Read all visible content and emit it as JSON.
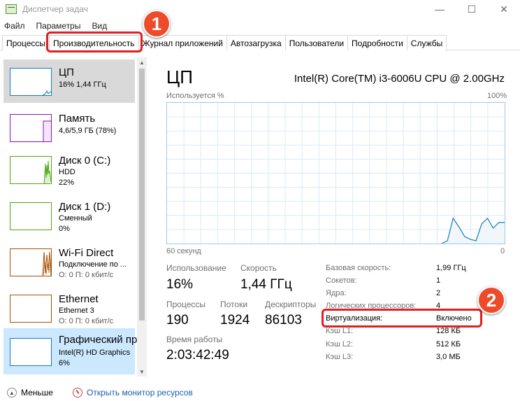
{
  "window": {
    "title": "Диспетчер задач",
    "controls": {
      "minimize": "—",
      "maximize": "☐",
      "close": "✕"
    }
  },
  "menu": [
    "Файл",
    "Параметры",
    "Вид"
  ],
  "tabs": [
    {
      "label": "Процессы"
    },
    {
      "label": "Производительность"
    },
    {
      "label": "Журнал приложений"
    },
    {
      "label": "Автозагрузка"
    },
    {
      "label": "Пользователи"
    },
    {
      "label": "Подробности"
    },
    {
      "label": "Службы"
    }
  ],
  "sidebar": {
    "items": [
      {
        "title": "ЦП",
        "sub1": "16% 1,44 ГГц",
        "color": "#117dbb"
      },
      {
        "title": "Память",
        "sub1": "4,6/5,9 ГБ (78%)",
        "color": "#8b12ae"
      },
      {
        "title": "Диск 0 (C:)",
        "sub1": "HDD",
        "sub2": "22%",
        "color": "#4da60c"
      },
      {
        "title": "Диск 1 (D:)",
        "sub1": "Сменный",
        "sub2": "0%",
        "color": "#4da60c"
      },
      {
        "title": "Wi-Fi Direct",
        "sub1": "Подключение по ...",
        "sub2": "О: 0 П: 0 кбит/с",
        "color": "#a74f01"
      },
      {
        "title": "Ethernet",
        "sub1": "Ethernet 3",
        "sub2": "О: 0 П: 0 кбит/с",
        "color": "#a74f01"
      },
      {
        "title": "Графический пр",
        "sub1": "Intel(R) HD Graphics",
        "sub2": "6%",
        "color": "#117dbb"
      }
    ]
  },
  "main": {
    "title": "ЦП",
    "cpu_name": "Intel(R) Core(TM) i3-6006U CPU @ 2.00GHz",
    "graph": {
      "top_left": "Используется %",
      "top_right": "100%",
      "bottom_left": "60 секунд",
      "bottom_right": "0",
      "line_color": "#117dbb",
      "usage_values": [
        0,
        0,
        0,
        0,
        0,
        0,
        0,
        0,
        0,
        0,
        0,
        0,
        0,
        0,
        0,
        0,
        0,
        0,
        0,
        0,
        0,
        0,
        0,
        0,
        0,
        0,
        0,
        0,
        0,
        0,
        0,
        0,
        0,
        0,
        0,
        0,
        0,
        0,
        0,
        0,
        0,
        0,
        0,
        0,
        0,
        0,
        0,
        0,
        0,
        2,
        18,
        12,
        5,
        3,
        2,
        14,
        18,
        11,
        15,
        15
      ]
    },
    "stats": {
      "utilization": {
        "label": "Использование",
        "value": "16%"
      },
      "speed": {
        "label": "Скорость",
        "value": "1,44 ГГц"
      },
      "processes": {
        "label": "Процессы",
        "value": "190"
      },
      "threads": {
        "label": "Потоки",
        "value": "1924"
      },
      "handles": {
        "label": "Дескрипторы",
        "value": "86103"
      },
      "uptime": {
        "label": "Время работы",
        "value": "2:03:42:49"
      }
    },
    "properties": [
      {
        "label": "Базовая скорость:",
        "value": "1,99 ГГц"
      },
      {
        "label": "Сокетов:",
        "value": "1"
      },
      {
        "label": "Ядра:",
        "value": "2"
      },
      {
        "label": "Логических процессоров:",
        "value": "4"
      },
      {
        "label": "Виртуализация:",
        "value": "Включено"
      },
      {
        "label": "Кэш L1:",
        "value": "128 КБ"
      },
      {
        "label": "Кэш L2:",
        "value": "512 КБ"
      },
      {
        "label": "Кэш L3:",
        "value": "3,0 МБ"
      }
    ]
  },
  "annotations": {
    "badge1": "1",
    "badge2": "2",
    "color": "#e02020"
  },
  "footer": {
    "less_label": "Меньше",
    "monitor_link": "Открыть монитор ресурсов"
  }
}
